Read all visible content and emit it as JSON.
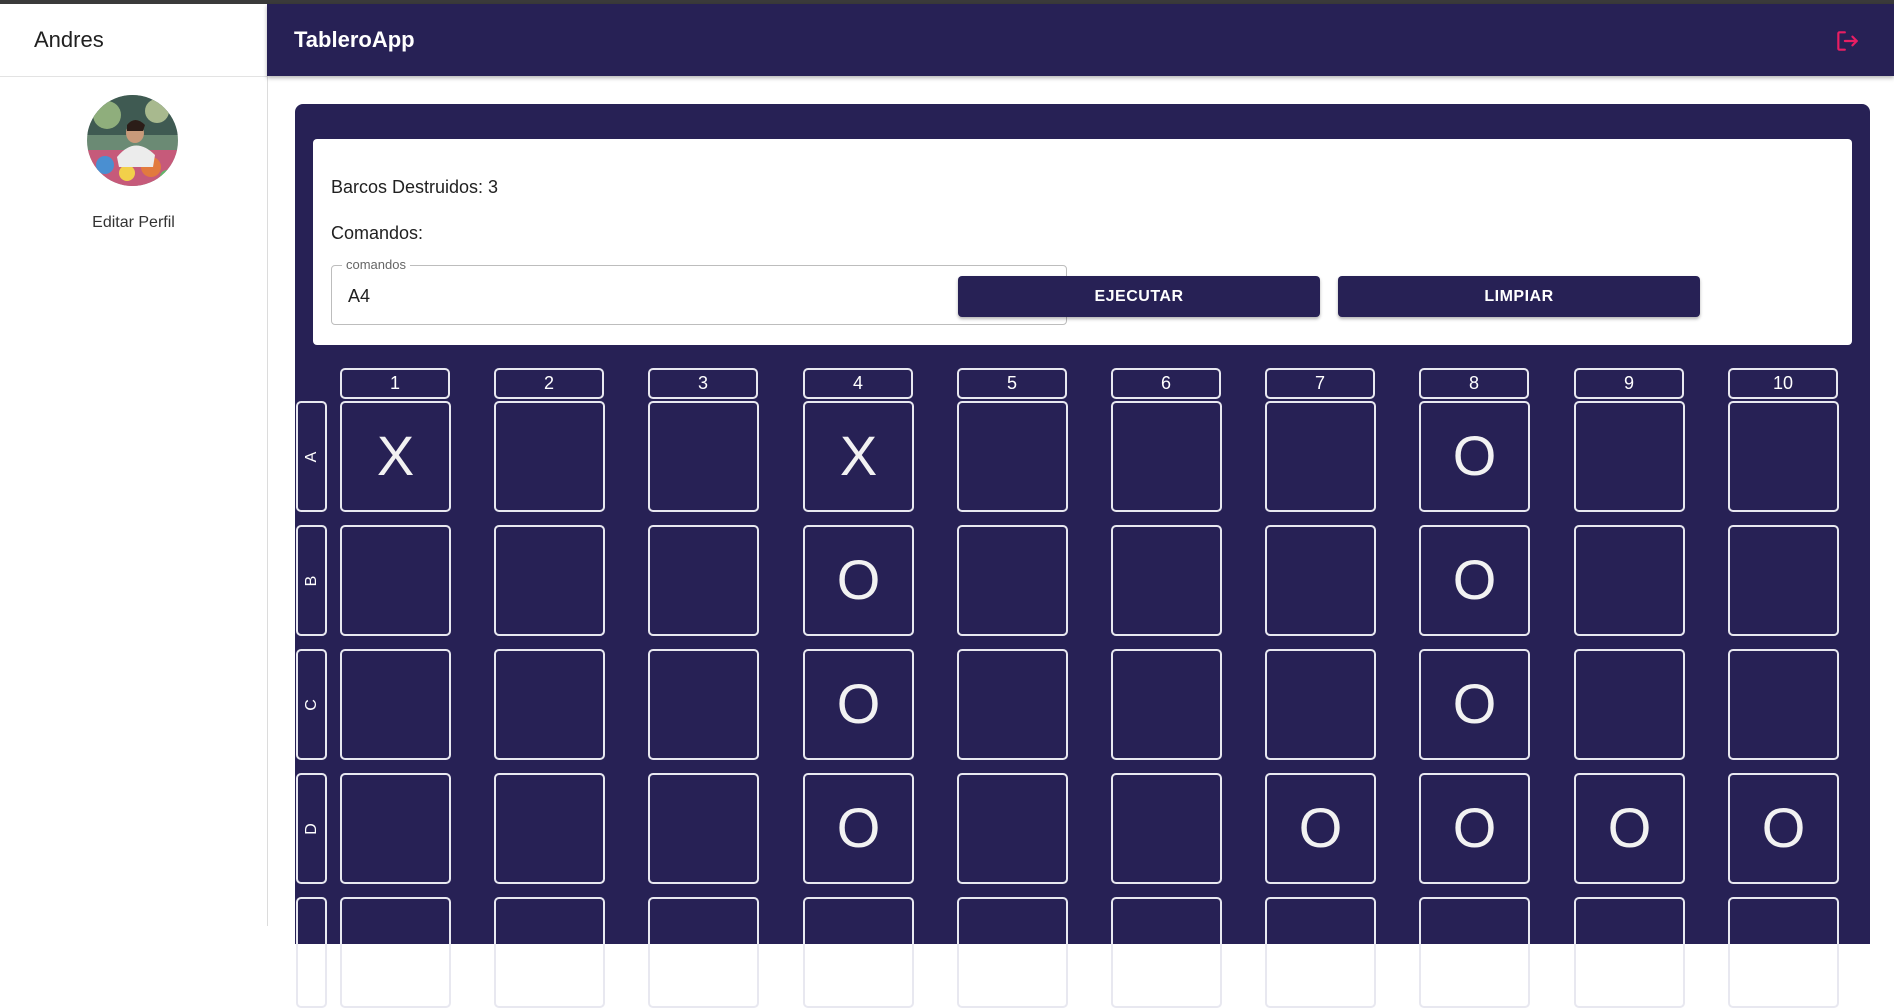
{
  "sidebar": {
    "user_name": "Andres",
    "edit_profile": "Editar Perfil"
  },
  "header": {
    "app_title": "TableroApp",
    "logout_icon": "logout-icon"
  },
  "game": {
    "destroyed_text": "Barcos Destruidos: 3",
    "commands_label": "Comandos:",
    "commands_field": {
      "legend": "comandos",
      "value": "A4"
    },
    "execute_label": "EJECUTAR",
    "clear_label": "LIMPIAR"
  },
  "board": {
    "columns": [
      "1",
      "2",
      "3",
      "4",
      "5",
      "6",
      "7",
      "8",
      "9",
      "10"
    ],
    "rows": [
      {
        "label": "A",
        "cells": [
          "X",
          "",
          "",
          "X",
          "",
          "",
          "",
          "O",
          "",
          ""
        ]
      },
      {
        "label": "B",
        "cells": [
          "",
          "",
          "",
          "O",
          "",
          "",
          "",
          "O",
          "",
          ""
        ]
      },
      {
        "label": "C",
        "cells": [
          "",
          "",
          "",
          "O",
          "",
          "",
          "",
          "O",
          "",
          ""
        ]
      },
      {
        "label": "D",
        "cells": [
          "",
          "",
          "",
          "O",
          "",
          "",
          "O",
          "O",
          "O",
          "O"
        ]
      },
      {
        "label": "",
        "cells": [
          "",
          "",
          "",
          "",
          "",
          "",
          "",
          "",
          "",
          ""
        ]
      }
    ]
  },
  "colors": {
    "primary": "#272155",
    "accent": "#e91e63",
    "grid_line": "#e8e8f0"
  }
}
